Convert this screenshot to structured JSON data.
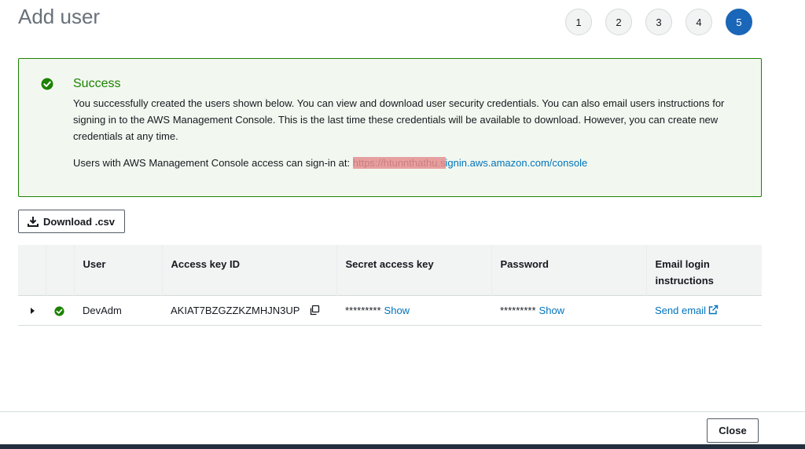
{
  "page": {
    "title": "Add user"
  },
  "steps": [
    "1",
    "2",
    "3",
    "4",
    "5"
  ],
  "active_step": "5",
  "alert": {
    "title": "Success",
    "body": "You successfully created the users shown below. You can view and download user security credentials. You can also email users instructions for signing in to the AWS Management Console. This is the last time these credentials will be available to download. However, you can create new credentials at any time.",
    "signin_prefix": "Users with AWS Management Console access can sign-in at: ",
    "signin_url_redacted": "https://htunnthathu.s",
    "signin_url_visible": "ignin.aws.amazon.com/console",
    "icon": "success-check-icon"
  },
  "toolbar": {
    "download_label": "Download .csv",
    "download_icon": "download-icon"
  },
  "table": {
    "headers": [
      "User",
      "Access key ID",
      "Secret access key",
      "Password",
      "Email login instructions"
    ],
    "rows": [
      {
        "user": "DevAdm",
        "access_key_id": "AKIAT7BZGZZKZMHJN3UP",
        "secret_masked": "*********",
        "secret_show": "Show",
        "password_masked": "*********",
        "password_show": "Show",
        "email_action": "Send email"
      }
    ]
  },
  "footer": {
    "close_label": "Close"
  },
  "colors": {
    "success": "#1d8102",
    "link": "#0073bb",
    "active_step": "#1a66b8"
  }
}
